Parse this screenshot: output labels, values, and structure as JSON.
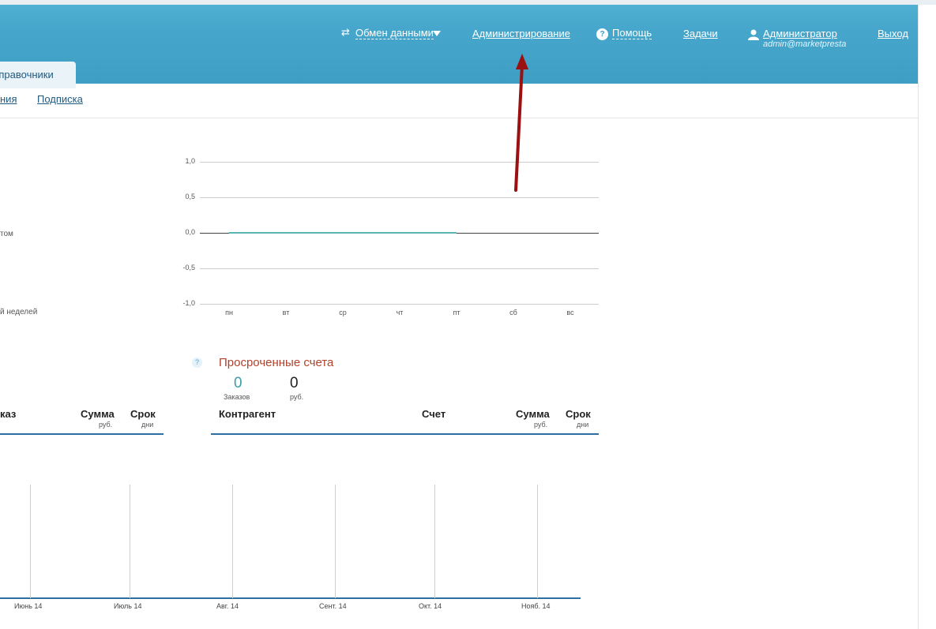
{
  "header": {
    "exchange_label": "Обмен данными",
    "admin_label": "Администрирование",
    "help_label": "Помощь",
    "tasks_label": "Задачи",
    "user_name": "Администратор",
    "user_email": "admin@marketpresta",
    "logout_label": "Выход"
  },
  "tabs": {
    "active_tab": "Справочники"
  },
  "subnav": {
    "link_partial": "ния",
    "subscription": "Подписка"
  },
  "side_labels": {
    "label_1": "том",
    "label_2": "й неделей"
  },
  "chart_data": [
    {
      "type": "line",
      "categories": [
        "пн",
        "вт",
        "ср",
        "чт",
        "пт",
        "сб",
        "вс"
      ],
      "series": [
        {
          "values": [
            0,
            0,
            0,
            0,
            0
          ],
          "color": "#5bb5b0"
        }
      ],
      "y_ticks": [
        "1,0",
        "0,5",
        "0,0",
        "-0,5",
        "-1,0"
      ],
      "ylim": [
        -1,
        1
      ],
      "grid": true
    },
    {
      "type": "line",
      "x_ticks": [
        "Июнь 14",
        "Июль 14",
        "Авг. 14",
        "Сент. 14",
        "Окт. 14",
        "Нояб. 14"
      ],
      "grid": true
    }
  ],
  "overdue": {
    "help_icon": "?",
    "title": "Просроченные счета",
    "orders_value": "0",
    "orders_label": "Заказов",
    "sum_value": "0",
    "sum_label": "руб."
  },
  "left_table": {
    "col_order": "каз",
    "col_sum": "Сумма",
    "col_sum_unit": "руб.",
    "col_term": "Срок",
    "col_term_unit": "дни"
  },
  "right_table": {
    "col_partner": "Контрагент",
    "col_invoice": "Счет",
    "col_sum": "Сумма",
    "col_sum_unit": "руб.",
    "col_term": "Срок",
    "col_term_unit": "дни"
  },
  "colors": {
    "header": "#44a4c9",
    "accent_link": "#1f5a80",
    "overdue_title": "#b0412a",
    "teal_number": "#3a9fa6",
    "annotation_arrow": "#9b1010"
  },
  "icons": {
    "exchange": "exchange-arrows-icon",
    "dropdown": "triangle-down-icon",
    "help": "question-circle-icon",
    "user": "user-icon"
  }
}
